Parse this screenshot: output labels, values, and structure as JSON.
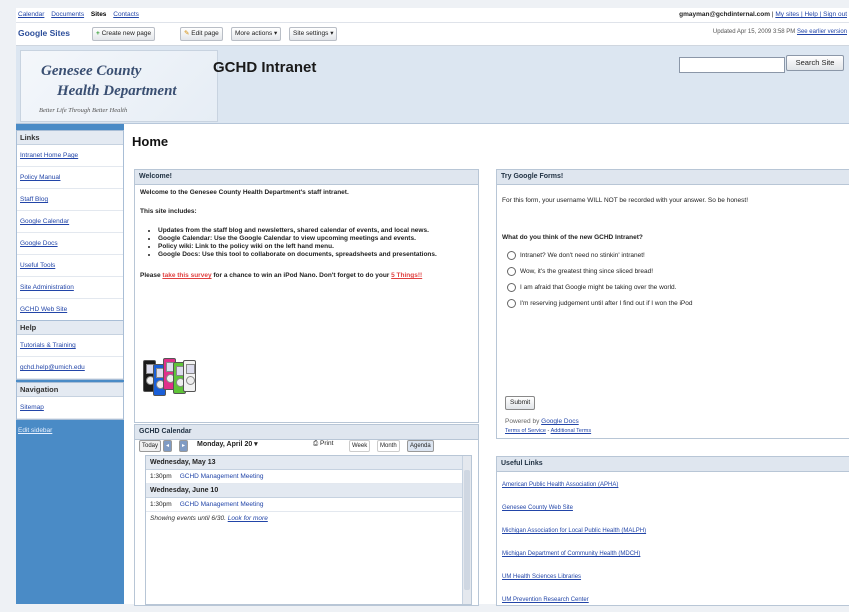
{
  "topbar": {
    "links": [
      "Calendar",
      "Documents",
      "Sites",
      "Contacts"
    ],
    "active": "Sites",
    "account": "gmayman@gchdinternal.com",
    "account_links": "My sites | Help | Sign out"
  },
  "toolbar": {
    "brand": "Google Sites",
    "create_label": "Create new page",
    "edit_label": "Edit page",
    "more_actions": "More actions ▾",
    "site_settings": "Site settings ▾",
    "updated": "Updated Apr 15, 2009 3:58 PM",
    "updated_link": "See earlier version"
  },
  "header": {
    "logo_line1": "Genesee County",
    "logo_line2": "Health Department",
    "logo_tagline": "Better Life Through Better Health",
    "site_title": "GCHD Intranet",
    "search_placeholder": "",
    "search_button": "Search Site"
  },
  "sidebar": {
    "links_title": "Links",
    "links": [
      "Intranet Home Page",
      "Policy Manual",
      "Staff Blog",
      "Google Calendar",
      "Google Docs",
      "Useful Tools",
      "Site Administration",
      "GCHD Web Site"
    ],
    "help_title": "Help",
    "help": [
      "Tutorials & Training",
      "gchd.help@umich.edu"
    ],
    "nav_title": "Navigation",
    "nav": [
      "Sitemap"
    ],
    "edit_sidebar": "Edit sidebar"
  },
  "main": {
    "title": "Home",
    "welcome": {
      "title": "Welcome!",
      "intro": "Welcome to the Genesee County Health Department's staff intranet.",
      "includes": "This site includes:",
      "bullets": [
        "Updates from the staff blog and newsletters, shared calendar of events, and local news.",
        "Google Calendar: Use the Google Calendar to view upcoming meetings and events.",
        "Policy wiki: Link to the policy wiki on the left hand menu.",
        "Google Docs: Use this tool to collaborate on documents, spreadsheets and presentations."
      ],
      "survey_pre": "Please ",
      "survey_link": "take this survey",
      "survey_mid": " for a chance to win an iPod Nano. Don't forget to do your ",
      "survey_link2": "5 Things!!"
    },
    "calendar": {
      "title": "GCHD Calendar",
      "today": "Today",
      "date_label": "Monday, April 20 ▾",
      "print": "Print",
      "views": [
        "Week",
        "Month",
        "Agenda"
      ],
      "days": [
        {
          "date": "Wednesday, May 13",
          "time": "1:30pm",
          "event": "GCHD Management Meeting"
        },
        {
          "date": "Wednesday, June 10",
          "time": "1:30pm",
          "event": "GCHD Management Meeting"
        }
      ],
      "footer": "Showing events until 6/30.",
      "footer_link": "Look for more"
    },
    "form": {
      "title": "Try Google Forms!",
      "note": "For this form, your username WILL NOT be recorded with your answer.  So be honest!",
      "question": "What do you think of the new GCHD Intranet?",
      "options": [
        "Intranet? We don't need no stinkin' intranet!",
        "Wow, it's the greatest thing since sliced bread!",
        "I am afraid that Google might be taking over the world.",
        "I'm reserving judgement until after I find out if I won the iPod"
      ],
      "submit": "Submit",
      "powered_pre": "Powered by ",
      "powered_link": "Google Docs",
      "terms": "Terms of Service",
      "sep": " - ",
      "terms2": "Additional Terms"
    },
    "useful_links": {
      "title": "Useful Links",
      "items": [
        "American Public Health Association (APHA)",
        "Genesee County Web Site",
        "Michigan Association for Local Public Health (MALPH)",
        "Michigan Department of Community Health (MDCH)",
        "UM Health Sciences Libraries",
        "UM Prevention Research Center"
      ]
    }
  },
  "colors": {
    "sidebar_bg": "#4a8bc6",
    "header_bg": "#dce6f1",
    "link": "#2245a8",
    "ipods": [
      "#1a1a1a",
      "#1a5fd8",
      "#e02f8a",
      "#5fc438",
      "#f2f2f2"
    ]
  }
}
